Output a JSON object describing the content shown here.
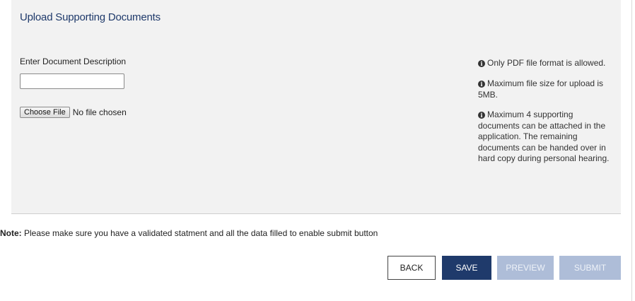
{
  "section": {
    "title": "Upload Supporting Documents",
    "description_label": "Enter Document Description",
    "description_value": "",
    "file_button_label": "Choose File",
    "file_status": "No file chosen"
  },
  "info": {
    "items": [
      "Only PDF file format is allowed.",
      "Maximum file size for upload is 5MB.",
      "Maximum 4 supporting documents can be attached in the application. The remaining documents can be handed over in hard copy during personal hearing."
    ],
    "icon": "info-circle-icon"
  },
  "note": {
    "prefix": "Note:",
    "text": "Please make sure you have a validated statment and all the data filled to enable submit button"
  },
  "actions": {
    "back_label": "BACK",
    "save_label": "SAVE",
    "preview_label": "PREVIEW",
    "submit_label": "SUBMIT"
  },
  "colors": {
    "primary": "#1f3a6b",
    "disabled": "#aebdd8",
    "panel_background": "#f2f2f2"
  }
}
